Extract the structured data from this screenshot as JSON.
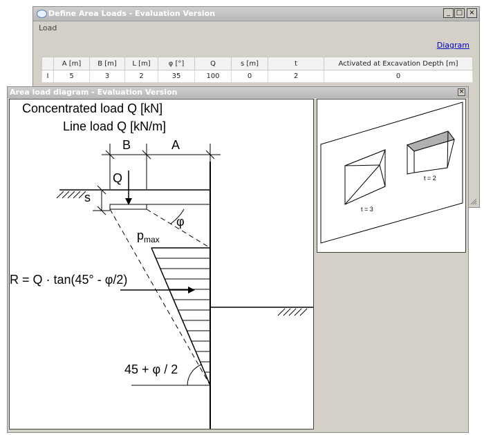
{
  "define_window": {
    "title": "Define Area Loads - Evaluation Version",
    "menu_load": "Load",
    "diagram_link": "Diagram",
    "controls": {
      "minimize": "_",
      "maximize": "□",
      "close": "×"
    },
    "columns": [
      "",
      "A [m]",
      "B [m]",
      "L [m]",
      "φ [°]",
      "Q",
      "s [m]",
      "t",
      "Activated at Excavation Depth [m]"
    ],
    "row": {
      "marker": "I",
      "A": "5",
      "B": "3",
      "L": "2",
      "phi": "35",
      "Q": "100",
      "s": "0",
      "t": "2",
      "depth": "0"
    }
  },
  "diagram_window": {
    "title": "Area load diagram - Evaluation Version",
    "close": "×",
    "diagram": {
      "concentrated_label": "Concentrated load Q [kN]",
      "line_label": "Line load Q [kN/m]",
      "label_B": "B",
      "label_A": "A",
      "label_Q": "Q",
      "label_s": "s",
      "label_phi": "φ",
      "label_pmax_main": "p",
      "label_pmax_sub": "max",
      "formula_R": "R = Q · tan(45° - φ/2)",
      "formula_angle": "45 + φ / 2"
    },
    "preview": {
      "label_t3": "t = 3",
      "label_t2": "t = 2"
    }
  }
}
